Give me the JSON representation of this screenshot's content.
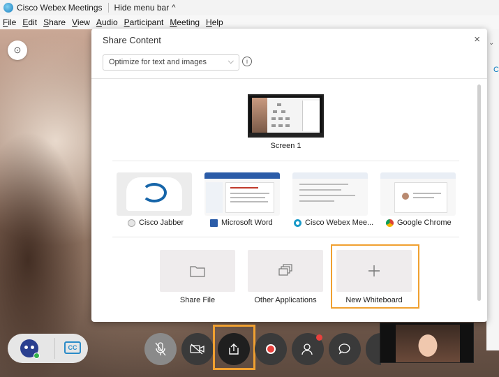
{
  "titlebar": {
    "app_title": "Cisco Webex Meetings",
    "hide_menu": "Hide menu bar",
    "chevron": "^"
  },
  "menubar": [
    "File",
    "Edit",
    "Share",
    "View",
    "Audio",
    "Participant",
    "Meeting",
    "Help"
  ],
  "modal": {
    "title": "Share Content",
    "close": "×",
    "optimize_value": "Optimize for text and images",
    "info": "i",
    "screen_label": "Screen 1",
    "apps": [
      {
        "label": "Cisco Jabber"
      },
      {
        "label": "Microsoft Word"
      },
      {
        "label": "Cisco Webex Mee..."
      },
      {
        "label": "Google Chrome"
      }
    ],
    "tiles": [
      {
        "label": "Share File"
      },
      {
        "label": "Other Applications"
      },
      {
        "label": "New Whiteboard"
      }
    ]
  },
  "controls": {
    "cc": "CC"
  },
  "colors": {
    "highlight": "#f0a030",
    "record": "#e8413d",
    "accent": "#1a7fc0"
  }
}
